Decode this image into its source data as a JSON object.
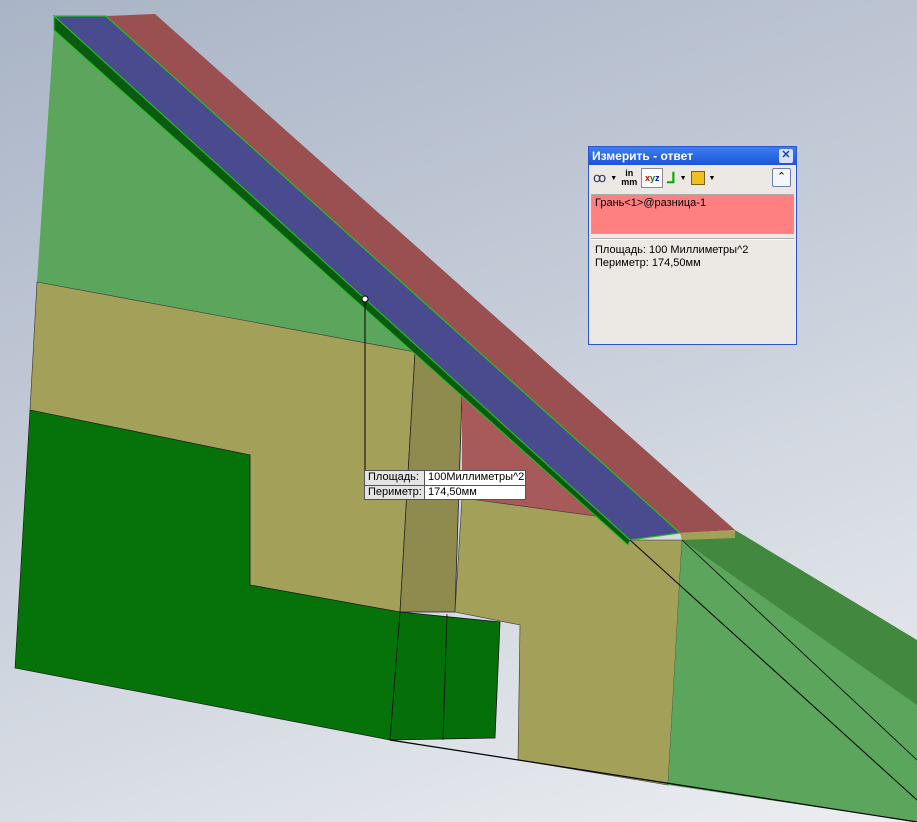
{
  "callout": {
    "area_label": "Площадь:",
    "area_value": "100Миллиметры^2",
    "perimeter_label": "Периметр:",
    "perimeter_value": "174,50мм"
  },
  "dialog": {
    "title": "Измерить - ответ",
    "close": "✕",
    "toolbar": {
      "units_in": "in",
      "units_mm": "mm",
      "collapse": "⌃"
    },
    "selection": "Грань<1>@разница-1",
    "results": [
      "Площадь: 100 Миллиметры^2",
      "Периметр: 174,50мм"
    ]
  },
  "colors": {
    "blue_face": "#4a4a8e",
    "red_face": "#9a4f50",
    "light_green": "#5ba55c",
    "khaki": "#a3a05a",
    "dark_green": "#05720a",
    "selection_bg": "#ff8080"
  }
}
